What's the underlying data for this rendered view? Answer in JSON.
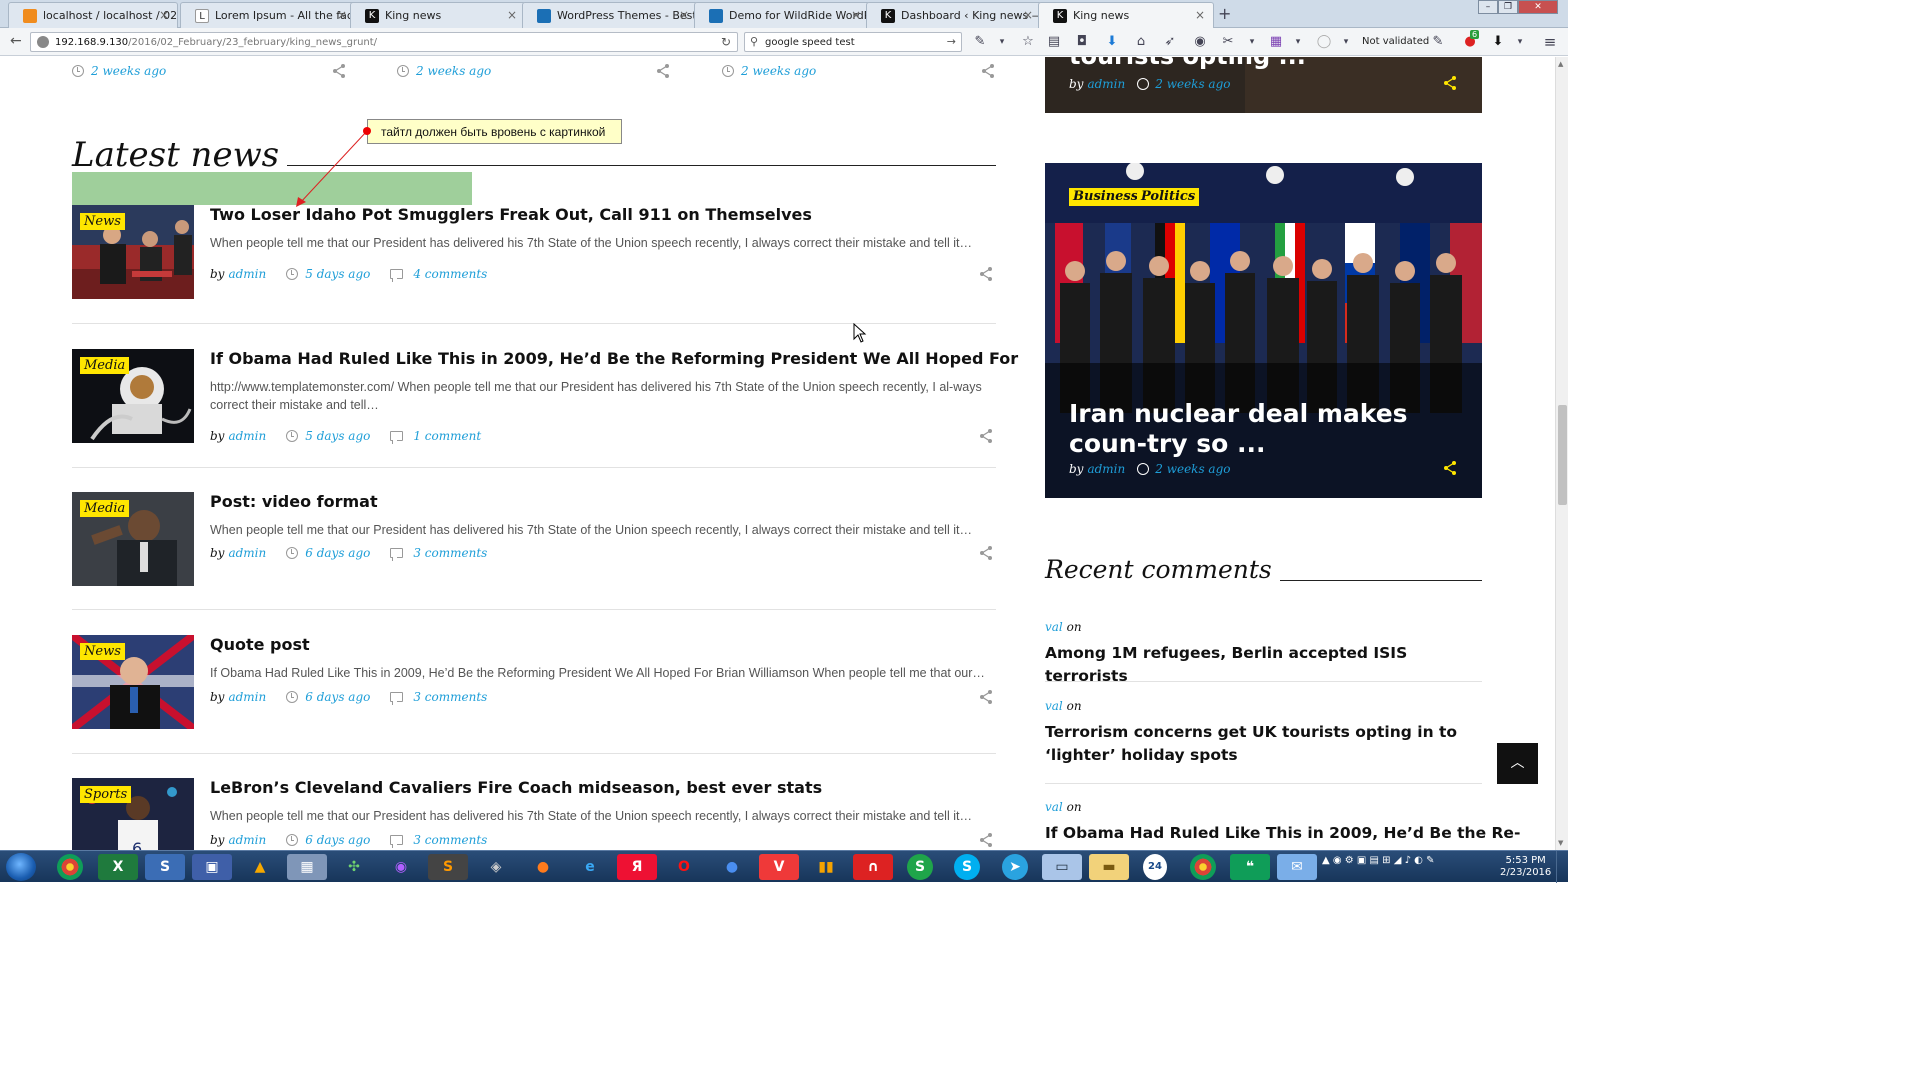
{
  "browser": {
    "tabs": [
      {
        "title": "localhost / localhost / 02-2...",
        "icon": "phpmyadmin-icon",
        "color": "#f08c1e"
      },
      {
        "title": "Lorem Ipsum - All the facts...",
        "icon": "lorem-ipsum-icon",
        "color": "#333333"
      },
      {
        "title": "King news",
        "icon": "king-news-icon",
        "color": "#111111"
      },
      {
        "title": "WordPress Themes - Best ...",
        "icon": "templatemonster-icon",
        "color": "#1b6fb5"
      },
      {
        "title": "Demo for WildRide WordPr...",
        "icon": "templatemonster-icon",
        "color": "#1b6fb5"
      },
      {
        "title": "Dashboard ‹ King news — ...",
        "icon": "king-news-icon",
        "color": "#111111"
      },
      {
        "title": "King news",
        "icon": "king-news-icon",
        "color": "#111111",
        "active": true
      }
    ],
    "new_tab": "+",
    "url_host": "192.168.9.130",
    "url_path": "/2016/02_February/23_february/king_news_grunt/",
    "search_value": "google speed test",
    "not_validated": "Not validated",
    "badge_count": "6"
  },
  "page": {
    "top_row_times": [
      "2 weeks ago",
      "2 weeks ago",
      "2 weeks ago"
    ],
    "latest_heading": "Latest news",
    "annotation_note": "тайтл должен быть вровень с картинкой",
    "posts": [
      {
        "category": "News",
        "title": "Two Loser Idaho Pot Smugglers Freak Out, Call 911 on Themselves",
        "excerpt": "When people tell me that our President has delivered his 7th State of the Union speech recently, I always correct their mistake and tell it…",
        "by": "by",
        "author": "admin",
        "time": "5 days ago",
        "comments": "4 comments"
      },
      {
        "category": "Media",
        "title": "If Obama Had Ruled Like This in 2009, He’d Be the Reforming President We All Hoped For",
        "excerpt": "http://www.templatemonster.com/ When people tell me that our President has delivered his 7th State of the Union speech recently, I al-ways correct their mistake and tell…",
        "by": "by",
        "author": "admin",
        "time": "5 days ago",
        "comments": "1 comment"
      },
      {
        "category": "Media",
        "title": "Post: video format",
        "excerpt": "When people tell me that our President has delivered his 7th State of the Union speech recently, I always correct their mistake and tell it…",
        "by": "by",
        "author": "admin",
        "time": "6 days ago",
        "comments": "3 comments"
      },
      {
        "category": "News",
        "title": "Quote post",
        "excerpt": "If Obama Had Ruled Like This in 2009, He’d Be the Reforming President We All Hoped For Brian Williamson When people tell me that our…",
        "by": "by",
        "author": "admin",
        "time": "6 days ago",
        "comments": "3 comments"
      },
      {
        "category": "Sports",
        "title": "LeBron’s Cleveland Cavaliers Fire Coach midseason, best ever stats",
        "excerpt": "When people tell me that our President has delivered his 7th State of the Union speech recently, I always correct their mistake and tell it…",
        "by": "by",
        "author": "admin",
        "time": "6 days ago",
        "comments": "3 comments"
      }
    ]
  },
  "sidebar": {
    "top_card": {
      "title_fragment": "tourists opting ...",
      "by": "by",
      "author": "admin",
      "time": "2 weeks ago"
    },
    "featured": {
      "tags": [
        "Business",
        "Politics"
      ],
      "title": "Iran nuclear deal makes coun-try so ...",
      "by": "by",
      "author": "admin",
      "time": "2 weeks ago"
    },
    "recent_heading": "Recent comments",
    "recent_comments": [
      {
        "author": "val",
        "on": "on",
        "title": "Among 1M refugees, Berlin accepted ISIS terrorists"
      },
      {
        "author": "val",
        "on": "on",
        "title": "Terrorism concerns get UK tourists opting in to ‘lighter’ holiday spots"
      },
      {
        "author": "val",
        "on": "on",
        "title": "If Obama Had Ruled Like This in 2009, He’d Be the Re-"
      }
    ]
  },
  "taskbar": {
    "time": "5:53 PM",
    "date": "2/23/2016",
    "apps": [
      "chrome-icon",
      "excel-icon",
      "skype-s-icon",
      "save-icon",
      "avast-icon",
      "calculator-icon",
      "network-icon",
      "browser-icon",
      "sublime-icon",
      "gamepad-icon",
      "firefox-icon",
      "ie-icon",
      "yandex-icon",
      "opera-icon",
      "app-icon",
      "vivaldi-icon",
      "bookmark-icon",
      "headphones-icon",
      "s-icon",
      "skype-icon",
      "telegram-icon",
      "notepad-icon",
      "folder-icon",
      "badge-24-icon",
      "chrome-icon",
      "hangouts-icon",
      "mail-icon"
    ]
  }
}
